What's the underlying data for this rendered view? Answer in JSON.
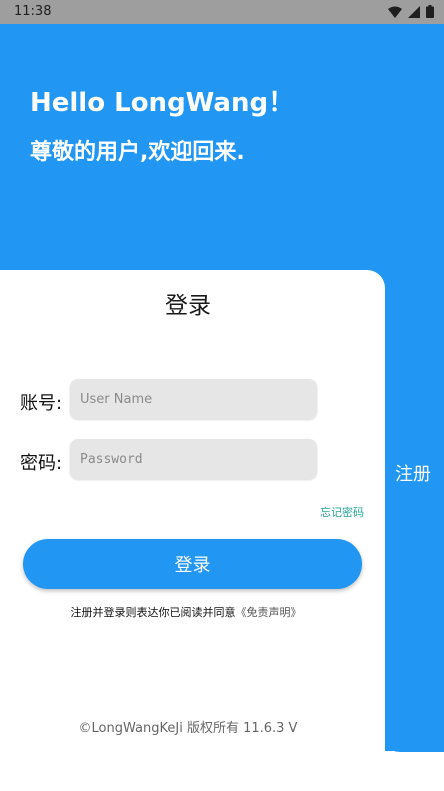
{
  "status_bar": {
    "time": "11:38",
    "icons": [
      "wifi-icon",
      "signal-icon",
      "battery-icon"
    ]
  },
  "header": {
    "greeting": "Hello LongWang！",
    "subtitle": "尊敬的用户,欢迎回来."
  },
  "register_tab": {
    "label": "注册"
  },
  "login_card": {
    "title": "登录",
    "username": {
      "label": "账号:",
      "placeholder": "User Name",
      "value": ""
    },
    "password": {
      "label": "密码:",
      "placeholder": "Password",
      "value": ""
    },
    "forgot_password": "忘记密码",
    "login_button": "登录",
    "agreement_text": "注册并登录则表达你已阅读并同意",
    "agreement_link": "《免责声明》"
  },
  "footer": {
    "copyright": "©LongWangKeJi 版权所有 11.6.3 V"
  },
  "colors": {
    "primary": "#2196f3",
    "status_bar": "#9e9e9e",
    "input_bg": "#e6e6e6",
    "forgot_link": "#26a69a"
  }
}
